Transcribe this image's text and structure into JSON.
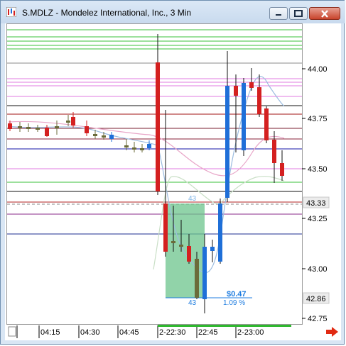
{
  "window": {
    "title": "S.MDLZ - Mondelez International, Inc., 3 Min"
  },
  "price_axis": {
    "ticks": [
      "44.00",
      "43.75",
      "43.50",
      "43.25",
      "43.00",
      "42.75"
    ],
    "current_price_tag": "43.33",
    "last_price_tag": "42.86"
  },
  "time_axis": {
    "labels": [
      "04:15",
      "04:30",
      "04:45",
      "2-22:30",
      "22:45",
      "2-23:00"
    ]
  },
  "measure_tool": {
    "bars_label_top": "43",
    "bars_label_bottom": "43",
    "amount": "$0.47",
    "percent": "1.09 %"
  },
  "colors": {
    "up_candle": "#1f6fd8",
    "down_candle": "#d42020",
    "neutral_candle": "#6b6b3a",
    "measure_box": "#6cc48c",
    "measure_text": "#1f7de0"
  },
  "icons": {
    "app": "chart-app-icon",
    "scroll": "scroll-right-arrow-icon"
  }
}
